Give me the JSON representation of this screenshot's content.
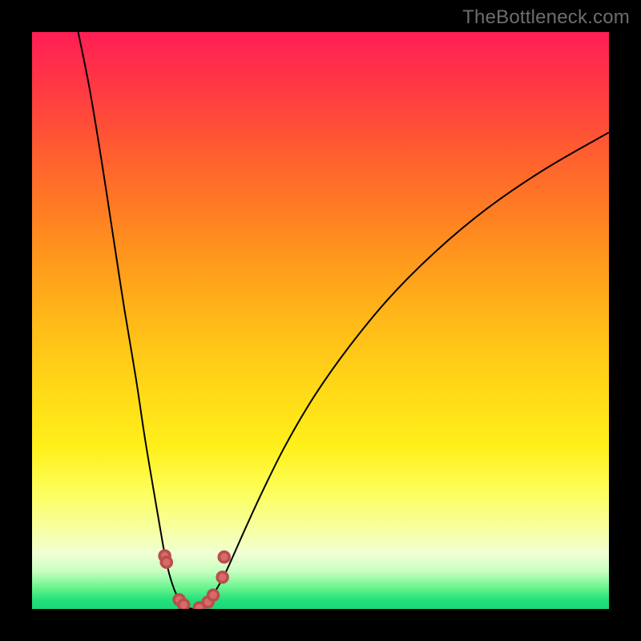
{
  "watermark": "TheBottleneck.com",
  "colors": {
    "black": "#000000",
    "marker_fill": "#d76a6a",
    "marker_stroke": "#b94e4c",
    "curve": "#000000",
    "gradient_stops": [
      {
        "offset": 0.0,
        "color": "#ff1e55"
      },
      {
        "offset": 0.1,
        "color": "#ff3a42"
      },
      {
        "offset": 0.22,
        "color": "#ff612e"
      },
      {
        "offset": 0.35,
        "color": "#ff8a1f"
      },
      {
        "offset": 0.48,
        "color": "#ffb319"
      },
      {
        "offset": 0.6,
        "color": "#ffd417"
      },
      {
        "offset": 0.72,
        "color": "#fff01a"
      },
      {
        "offset": 0.8,
        "color": "#fdff5f"
      },
      {
        "offset": 0.86,
        "color": "#f7ffa0"
      },
      {
        "offset": 0.905,
        "color": "#efffd4"
      },
      {
        "offset": 0.935,
        "color": "#c7ffc0"
      },
      {
        "offset": 0.962,
        "color": "#6cf58f"
      },
      {
        "offset": 0.985,
        "color": "#22e07a"
      },
      {
        "offset": 1.0,
        "color": "#19d877"
      }
    ]
  },
  "chart_data": {
    "type": "line",
    "title": "",
    "xlabel": "",
    "ylabel": "",
    "xlim": [
      0,
      100
    ],
    "ylim": [
      0,
      100
    ],
    "grid": false,
    "legend": false,
    "left_curve": [
      {
        "x": 8.0,
        "y": 100.0
      },
      {
        "x": 10.0,
        "y": 90.0
      },
      {
        "x": 12.0,
        "y": 78.0
      },
      {
        "x": 14.0,
        "y": 65.0
      },
      {
        "x": 16.0,
        "y": 52.0
      },
      {
        "x": 18.0,
        "y": 40.0
      },
      {
        "x": 19.5,
        "y": 30.0
      },
      {
        "x": 21.0,
        "y": 21.0
      },
      {
        "x": 22.2,
        "y": 14.0
      },
      {
        "x": 23.0,
        "y": 9.5
      },
      {
        "x": 23.8,
        "y": 6.0
      },
      {
        "x": 24.6,
        "y": 3.5
      },
      {
        "x": 25.4,
        "y": 1.8
      },
      {
        "x": 26.2,
        "y": 0.8
      },
      {
        "x": 27.0,
        "y": 0.2
      },
      {
        "x": 28.0,
        "y": 0.0
      }
    ],
    "right_curve": [
      {
        "x": 28.0,
        "y": 0.0
      },
      {
        "x": 29.0,
        "y": 0.2
      },
      {
        "x": 30.0,
        "y": 0.9
      },
      {
        "x": 31.0,
        "y": 2.0
      },
      {
        "x": 32.2,
        "y": 3.8
      },
      {
        "x": 33.5,
        "y": 6.2
      },
      {
        "x": 35.0,
        "y": 9.5
      },
      {
        "x": 37.0,
        "y": 14.0
      },
      {
        "x": 40.0,
        "y": 20.5
      },
      {
        "x": 44.0,
        "y": 28.5
      },
      {
        "x": 49.0,
        "y": 37.0
      },
      {
        "x": 55.0,
        "y": 45.5
      },
      {
        "x": 62.0,
        "y": 54.0
      },
      {
        "x": 70.0,
        "y": 62.0
      },
      {
        "x": 79.0,
        "y": 69.5
      },
      {
        "x": 89.0,
        "y": 76.3
      },
      {
        "x": 100.0,
        "y": 82.6
      }
    ],
    "markers": [
      {
        "x": 23.0,
        "y": 9.2
      },
      {
        "x": 23.3,
        "y": 8.1
      },
      {
        "x": 25.5,
        "y": 1.6
      },
      {
        "x": 26.3,
        "y": 0.7
      },
      {
        "x": 29.0,
        "y": 0.2
      },
      {
        "x": 30.5,
        "y": 1.2
      },
      {
        "x": 31.4,
        "y": 2.4
      },
      {
        "x": 33.0,
        "y": 5.5
      },
      {
        "x": 33.3,
        "y": 9.0
      }
    ]
  }
}
